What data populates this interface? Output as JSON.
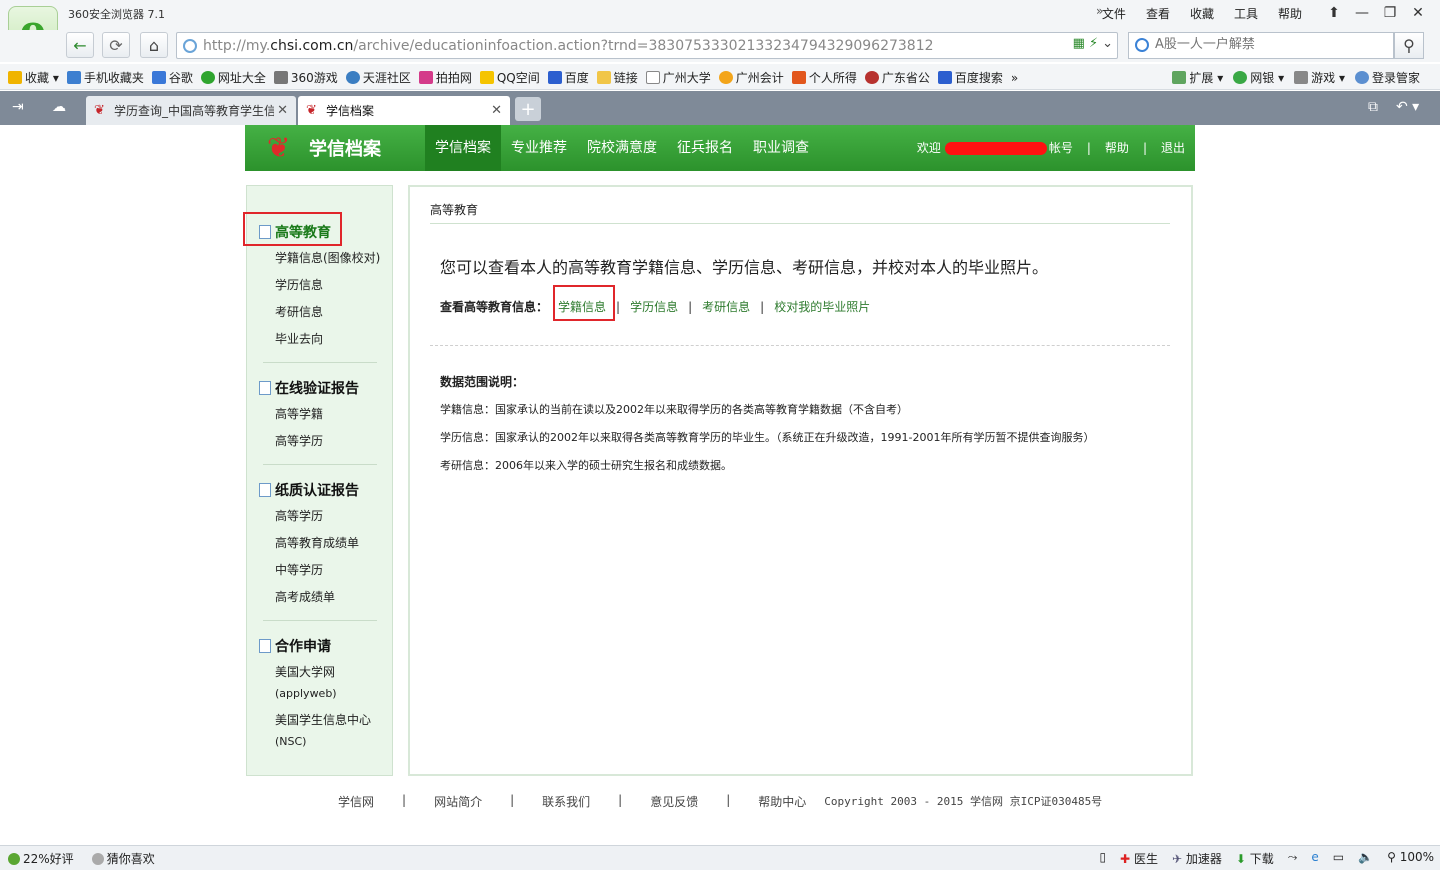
{
  "browser": {
    "app_title": "360安全浏览器 7.1",
    "menu": [
      "文件",
      "查看",
      "收藏",
      "工具",
      "帮助"
    ],
    "url_prefix": "http://my.",
    "url_host": "chsi.com.cn",
    "url_path": "/archive/educationinfoaction.action?trnd=38307533302133234794329096273812",
    "search_placeholder": "A股一人一户解禁",
    "bookmarks": [
      "收藏",
      "手机收藏夹",
      "谷歌",
      "网址大全",
      "360游戏",
      "天涯社区",
      "拍拍网",
      "QQ空间",
      "百度",
      "链接",
      "广州大学",
      "广州会计",
      "个人所得",
      "广东省公",
      "百度搜索"
    ],
    "bookmarks_right": [
      "扩展",
      "网银",
      "游戏",
      "登录管家"
    ],
    "tabs": [
      {
        "label": "学历查询_中国高等教育学生信"
      },
      {
        "label": "学信档案"
      }
    ],
    "status_left": [
      "22%好评",
      "猜你喜欢"
    ],
    "status_right": [
      "医生",
      "加速器",
      "下载",
      "100%"
    ]
  },
  "site": {
    "logo_text": "学信档案",
    "nav": [
      "学信档案",
      "专业推荐",
      "院校满意度",
      "征兵报名",
      "职业调查"
    ],
    "welcome": "欢迎",
    "account": "帐号",
    "help": "帮助",
    "logout": "退出",
    "sep": "|"
  },
  "sidebar": {
    "sections": [
      {
        "title": "高等教育",
        "items": [
          "学籍信息(图像校对)",
          "学历信息",
          "考研信息",
          "毕业去向"
        ]
      },
      {
        "title": "在线验证报告",
        "items": [
          "高等学籍",
          "高等学历"
        ]
      },
      {
        "title": "纸质认证报告",
        "items": [
          "高等学历",
          "高等教育成绩单",
          "中等学历",
          "高考成绩单"
        ]
      },
      {
        "title": "合作申请",
        "items": [
          "美国大学网",
          "(applyweb)",
          "美国学生信息中心",
          "(NSC)"
        ]
      }
    ]
  },
  "content": {
    "breadcrumb": "高等教育",
    "intro": "您可以查看本人的高等教育学籍信息、学历信息、考研信息，并校对本人的毕业照片。",
    "view_label": "查看高等教育信息：",
    "links": [
      "学籍信息",
      "学历信息",
      "考研信息",
      "校对我的毕业照片"
    ],
    "scope_title": "数据范围说明：",
    "scope_lines": [
      "学籍信息：国家承认的当前在读以及2002年以来取得学历的各类高等教育学籍数据（不含自考）",
      "学历信息：国家承认的2002年以来取得各类高等教育学历的毕业生。（系统正在升级改造，1991-2001年所有学历暂不提供查询服务）",
      "考研信息：2006年以来入学的硕士研究生报名和成绩数据。"
    ]
  },
  "footer": {
    "links": [
      "学信网",
      "网站简介",
      "联系我们",
      "意见反馈",
      "帮助中心"
    ],
    "copyright": "Copyright 2003 - 2015  学信网  京ICP证030485号"
  }
}
